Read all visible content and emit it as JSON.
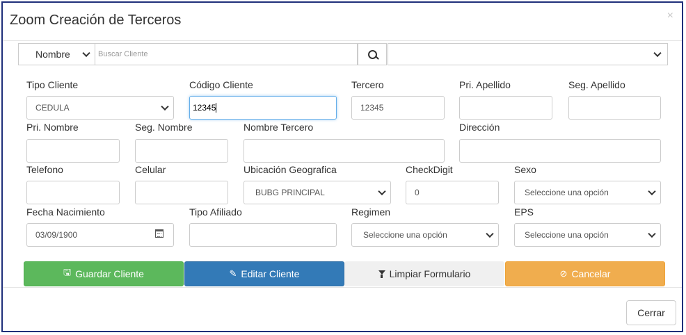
{
  "modal": {
    "title": "Zoom Creación de Terceros",
    "close_symbol": "×"
  },
  "search": {
    "field_selected": "Nombre",
    "placeholder": "Buscar Cliente",
    "result_selected": ""
  },
  "fields": {
    "tipo_cliente": {
      "label": "Tipo Cliente",
      "value": "CEDULA"
    },
    "codigo_cliente": {
      "label": "Código Cliente",
      "value": "12345"
    },
    "tercero": {
      "label": "Tercero",
      "value": "12345"
    },
    "pri_apellido": {
      "label": "Pri. Apellido",
      "value": ""
    },
    "seg_apellido": {
      "label": "Seg. Apellido",
      "value": ""
    },
    "pri_nombre": {
      "label": "Pri. Nombre",
      "value": ""
    },
    "seg_nombre": {
      "label": "Seg. Nombre",
      "value": ""
    },
    "nombre_tercero": {
      "label": "Nombre Tercero",
      "value": ""
    },
    "direccion": {
      "label": "Dirección",
      "value": ""
    },
    "telefono": {
      "label": "Telefono",
      "value": ""
    },
    "celular": {
      "label": "Celular",
      "value": ""
    },
    "ubicacion": {
      "label": "Ubicación Geografica",
      "value": "BUBG PRINCIPAL"
    },
    "checkdigit": {
      "label": "CheckDigit",
      "value": "0"
    },
    "sexo": {
      "label": "Sexo",
      "value": "Seleccione una opción"
    },
    "fecha_nacimiento": {
      "label": "Fecha Nacimiento",
      "value": "03/09/1900"
    },
    "tipo_afiliado": {
      "label": "Tipo Afiliado",
      "value": ""
    },
    "regimen": {
      "label": "Regimen",
      "value": "Seleccione una opción"
    },
    "eps": {
      "label": "EPS",
      "value": "Seleccione una opción"
    }
  },
  "actions": {
    "save": "Guardar Cliente",
    "edit": "Editar Cliente",
    "clear": "Limpiar Formulario",
    "cancel": "Cancelar"
  },
  "footer": {
    "close": "Cerrar"
  },
  "colors": {
    "save": "#5cb85c",
    "edit": "#337ab7",
    "clear": "#f0f0f0",
    "cancel": "#f0ad4e",
    "frame": "#1f2f7a"
  },
  "icons": {
    "save": "floppy-disk-icon",
    "edit": "pencil-square-icon",
    "clear": "filter-icon",
    "cancel": "ban-icon",
    "search": "search-icon",
    "date": "calendar-icon"
  }
}
